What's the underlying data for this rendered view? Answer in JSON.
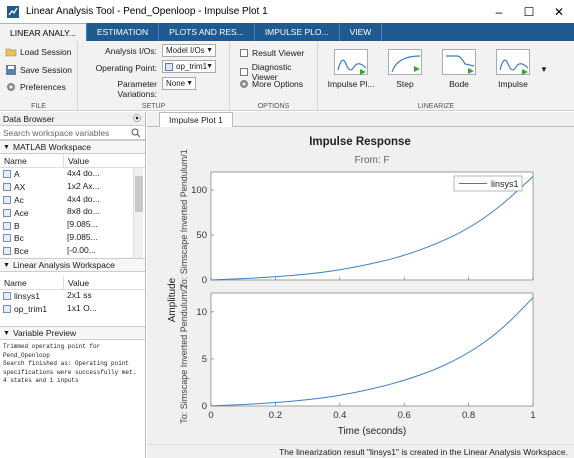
{
  "window": {
    "title": "Linear Analysis Tool - Pend_Openloop - Impulse Plot 1",
    "minimize": "–",
    "maximize": "☐",
    "close": "✕"
  },
  "ribbon_tabs": [
    {
      "label": "LINEAR ANALY...",
      "active": true
    },
    {
      "label": "ESTIMATION",
      "active": false
    },
    {
      "label": "PLOTS AND RES...",
      "active": false
    },
    {
      "label": "IMPULSE PLO...",
      "active": false
    },
    {
      "label": "VIEW",
      "active": false
    }
  ],
  "file_group": {
    "load_session": "Load Session",
    "save_session": "Save Session",
    "preferences": "Preferences",
    "label": "FILE"
  },
  "setup_group": {
    "analysis_ios_label": "Analysis I/Os:",
    "analysis_ios_value": "Model I/Os",
    "operating_point_label": "Operating Point:",
    "operating_point_value": "op_trim1",
    "param_variations_label": "Parameter Variations:",
    "param_variations_value": "None",
    "label": "SETUP"
  },
  "options_group": {
    "result_viewer": "Result Viewer",
    "diagnostic_viewer": "Diagnostic Viewer",
    "more_options": "More Options",
    "label": "OPTIONS"
  },
  "linearize_group": {
    "buttons": [
      "Impulse Pl...",
      "Step",
      "Bode",
      "Impulse"
    ],
    "label": "LINEARIZE"
  },
  "data_browser": {
    "title": "Data Browser",
    "search_placeholder": "Search workspace variables",
    "matlab_ws": {
      "title": "MATLAB Workspace",
      "col_name": "Name",
      "col_value": "Value",
      "rows": [
        {
          "name": "A",
          "value": "4x4 do..."
        },
        {
          "name": "AX",
          "value": "1x2 Ax..."
        },
        {
          "name": "Ac",
          "value": "4x4 do..."
        },
        {
          "name": "Ace",
          "value": "8x8 do..."
        },
        {
          "name": "B",
          "value": "[9.085..."
        },
        {
          "name": "Bc",
          "value": "[9.085..."
        },
        {
          "name": "Bce",
          "value": "[-0.00..."
        }
      ]
    },
    "linear_ws": {
      "title": "Linear Analysis Workspace",
      "col_name": "Name",
      "col_value": "Value",
      "rows": [
        {
          "name": "linsys1",
          "value": "2x1 ss"
        },
        {
          "name": "op_trim1",
          "value": "1x1 O..."
        }
      ]
    },
    "preview": {
      "title": "Variable Preview",
      "text": "Trimmed operating point for\nPend_Openloop\nSearch finished as: Operating point\nspecifications were successfully met.\n4 states and 1 inputs"
    }
  },
  "doc_tab": "Impulse Plot 1",
  "plot": {
    "title": "Impulse Response",
    "from_label": "From: F",
    "ylabel": "Amplitude",
    "xlabel": "Time (seconds)",
    "row_label_top": "To: Simscape Inverted Pendulum/1",
    "row_label_bottom": "To: Simscape Inverted Pendulum/2",
    "legend": "linsys1",
    "series_color": "#3d7fc1"
  },
  "chart_data": {
    "type": "line",
    "title": "Impulse Response",
    "xlabel": "Time (seconds)",
    "ylabel": "Amplitude",
    "xlim": [
      0,
      1
    ],
    "x_ticks": [
      "0",
      "0.2",
      "0.4",
      "0.6",
      "0.8",
      "1"
    ],
    "subplots": [
      {
        "name": "To: Simscape Inverted Pendulum/1",
        "ylim": [
          0,
          120
        ],
        "y_ticks": [
          "0",
          "50",
          "100"
        ],
        "series": [
          {
            "name": "linsys1",
            "x": [
              0,
              0.1,
              0.2,
              0.3,
              0.4,
              0.5,
              0.6,
              0.7,
              0.8,
              0.9,
              1.0
            ],
            "y": [
              0,
              1.5,
              3.5,
              6.5,
              11,
              18,
              27,
              40,
              57,
              82,
              115
            ]
          }
        ]
      },
      {
        "name": "To: Simscape Inverted Pendulum/2",
        "ylim": [
          0,
          12
        ],
        "y_ticks": [
          "0",
          "5",
          "10"
        ],
        "series": [
          {
            "name": "linsys1",
            "x": [
              0,
              0.1,
              0.2,
              0.3,
              0.4,
              0.5,
              0.6,
              0.7,
              0.8,
              0.9,
              1.0
            ],
            "y": [
              0,
              0.15,
              0.35,
              0.65,
              1.1,
              1.8,
              2.7,
              3.9,
              5.6,
              8.0,
              11.5
            ]
          }
        ]
      }
    ]
  },
  "status": "The linearization result \"linsys1\" is created in the Linear Analysis Workspace."
}
